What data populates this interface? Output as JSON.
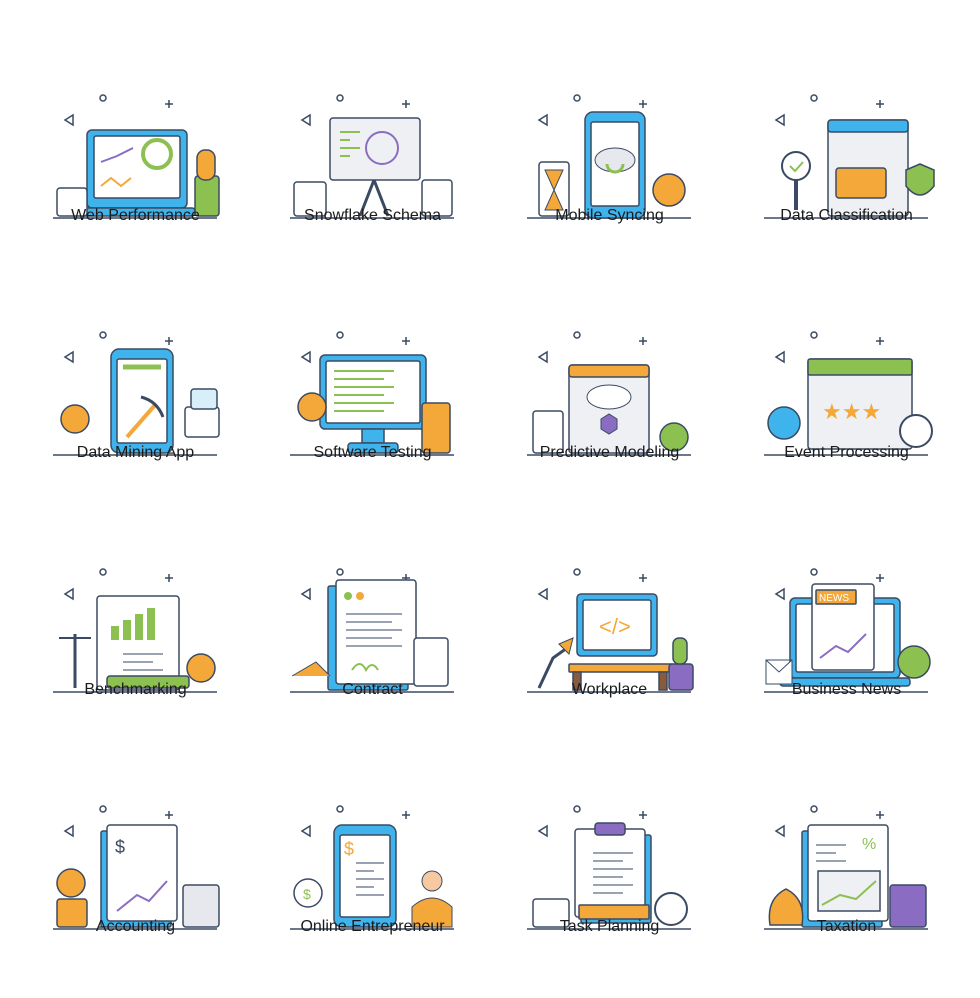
{
  "colors": {
    "outline": "#3b4a63",
    "blue": "#3fb4ec",
    "lightblue": "#d8eef9",
    "orange": "#f4a83a",
    "green": "#8cc152",
    "purple": "#8a6dc2",
    "grey": "#eef0f4"
  },
  "tiles": [
    {
      "label": "Web Performance",
      "icon": "laptop-dashboard-icon"
    },
    {
      "label": "Snowflake Schema",
      "icon": "presentation-board-icon"
    },
    {
      "label": "Mobile Syncing",
      "icon": "smartphone-sync-icon"
    },
    {
      "label": "Data Classification",
      "icon": "browser-folder-icon"
    },
    {
      "label": "Data Mining App",
      "icon": "phone-pickaxe-icon"
    },
    {
      "label": "Software Testing",
      "icon": "monitor-bug-icon"
    },
    {
      "label": "Predictive Modeling",
      "icon": "cloud-network-icon"
    },
    {
      "label": "Event Processing",
      "icon": "calendar-stars-icon"
    },
    {
      "label": "Benchmarking",
      "icon": "report-scale-icon"
    },
    {
      "label": "Contract",
      "icon": "contract-document-icon"
    },
    {
      "label": "Workplace",
      "icon": "desk-monitor-code-icon"
    },
    {
      "label": "Business News",
      "icon": "laptop-news-icon"
    },
    {
      "label": "Accounting",
      "icon": "ledger-coins-icon"
    },
    {
      "label": "Online Entrepreneur",
      "icon": "phone-businessman-icon"
    },
    {
      "label": "Task Planning",
      "icon": "clipboard-checklist-icon"
    },
    {
      "label": "Taxation",
      "icon": "tax-document-icon"
    }
  ]
}
